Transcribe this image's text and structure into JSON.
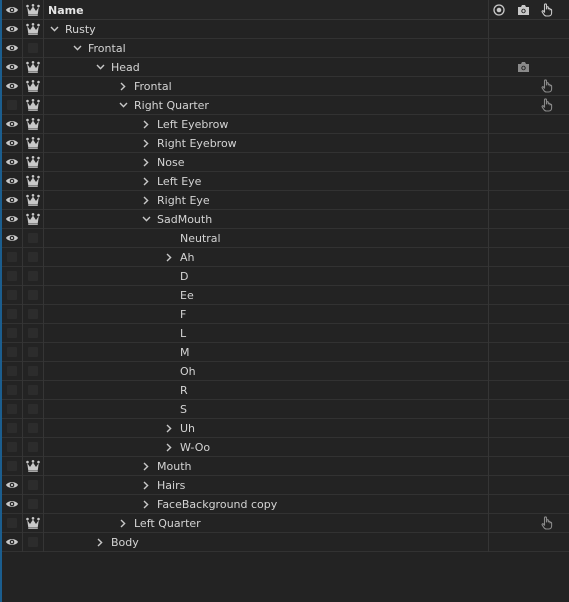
{
  "header": {
    "name_label": "Name",
    "icons": [
      "eye-icon",
      "crown-icon",
      "origin-icon",
      "camera-icon",
      "hand-icon"
    ]
  },
  "colors": {
    "background": "#232323",
    "row_line": "#323232",
    "icon": "#c8c8c8",
    "dim_icon": "#8a8a8a",
    "selection_edge": "#1b5e8f"
  },
  "layers": [
    {
      "label": "Rusty",
      "depth": 0,
      "twisty": "open",
      "eye": true,
      "crown": true
    },
    {
      "label": "Frontal",
      "depth": 1,
      "twisty": "open",
      "eye": true,
      "crown": false
    },
    {
      "label": "Head",
      "depth": 2,
      "twisty": "open",
      "eye": true,
      "crown": true,
      "camera": true
    },
    {
      "label": "Frontal",
      "depth": 3,
      "twisty": "closed",
      "eye": true,
      "crown": true,
      "hand": true
    },
    {
      "label": "Right Quarter",
      "depth": 3,
      "twisty": "open",
      "eye": false,
      "crown": true,
      "hand": true
    },
    {
      "label": "Left Eyebrow",
      "depth": 4,
      "twisty": "closed",
      "eye": true,
      "crown": true
    },
    {
      "label": "Right Eyebrow",
      "depth": 4,
      "twisty": "closed",
      "eye": true,
      "crown": true
    },
    {
      "label": "Nose",
      "depth": 4,
      "twisty": "closed",
      "eye": true,
      "crown": true
    },
    {
      "label": "Left Eye",
      "depth": 4,
      "twisty": "closed",
      "eye": true,
      "crown": true
    },
    {
      "label": "Right Eye",
      "depth": 4,
      "twisty": "closed",
      "eye": true,
      "crown": true
    },
    {
      "label": "SadMouth",
      "depth": 4,
      "twisty": "open",
      "eye": true,
      "crown": true
    },
    {
      "label": "Neutral",
      "depth": 5,
      "twisty": "none",
      "eye": true,
      "crown": false
    },
    {
      "label": "Ah",
      "depth": 5,
      "twisty": "closed",
      "eye": false,
      "crown": false
    },
    {
      "label": "D",
      "depth": 5,
      "twisty": "none",
      "eye": false,
      "crown": false
    },
    {
      "label": "Ee",
      "depth": 5,
      "twisty": "none",
      "eye": false,
      "crown": false
    },
    {
      "label": "F",
      "depth": 5,
      "twisty": "none",
      "eye": false,
      "crown": false
    },
    {
      "label": "L",
      "depth": 5,
      "twisty": "none",
      "eye": false,
      "crown": false
    },
    {
      "label": "M",
      "depth": 5,
      "twisty": "none",
      "eye": false,
      "crown": false
    },
    {
      "label": "Oh",
      "depth": 5,
      "twisty": "none",
      "eye": false,
      "crown": false
    },
    {
      "label": "R",
      "depth": 5,
      "twisty": "none",
      "eye": false,
      "crown": false
    },
    {
      "label": "S",
      "depth": 5,
      "twisty": "none",
      "eye": false,
      "crown": false
    },
    {
      "label": "Uh",
      "depth": 5,
      "twisty": "closed",
      "eye": false,
      "crown": false
    },
    {
      "label": "W-Oo",
      "depth": 5,
      "twisty": "closed",
      "eye": false,
      "crown": false
    },
    {
      "label": "Mouth",
      "depth": 4,
      "twisty": "closed",
      "eye": false,
      "crown": true
    },
    {
      "label": "Hairs",
      "depth": 4,
      "twisty": "closed",
      "eye": true,
      "crown": false
    },
    {
      "label": "FaceBackground copy",
      "depth": 4,
      "twisty": "closed",
      "eye": true,
      "crown": false
    },
    {
      "label": "Left Quarter",
      "depth": 3,
      "twisty": "closed",
      "eye": false,
      "crown": true,
      "hand": true
    },
    {
      "label": "Body",
      "depth": 2,
      "twisty": "closed",
      "eye": true,
      "crown": false
    }
  ]
}
